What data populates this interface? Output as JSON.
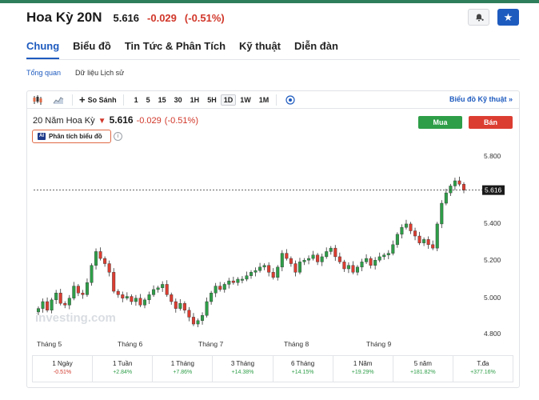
{
  "header": {
    "title": "Hoa Kỳ 20N",
    "price": "5.616",
    "change": "-0.029",
    "change_pct": "(-0.51%)"
  },
  "nav": {
    "tabs": [
      {
        "label": "Chung",
        "active": true
      },
      {
        "label": "Biểu đồ"
      },
      {
        "label": "Tin Tức & Phân Tích"
      },
      {
        "label": "Kỹ thuật"
      },
      {
        "label": "Diễn đàn"
      }
    ]
  },
  "subnav": {
    "items": [
      {
        "label": "Tổng quan",
        "active": true
      },
      {
        "label": "Dữ liệu Lịch sử"
      }
    ]
  },
  "toolbar": {
    "compare_label": "So Sánh",
    "intervals": [
      "1",
      "5",
      "15",
      "30",
      "1H",
      "5H",
      "1D",
      "1W",
      "1M"
    ],
    "active_interval": "1D",
    "right_link": "Biểu đồ Kỹ thuật »"
  },
  "instrument": {
    "name": "20 Năm Hoa Kỳ",
    "price": "5.616",
    "change": "-0.029",
    "change_pct": "(-0.51%)",
    "buy_label": "Mua",
    "sell_label": "Bán",
    "analysis_label": "Phân tích biểu đồ",
    "ai_badge": "AI",
    "info_glyph": "i"
  },
  "chart_data": {
    "type": "candlestick",
    "y_ticks": [
      "5.800",
      "5.400",
      "5.200",
      "5.000",
      "4.800"
    ],
    "ylim": [
      4.78,
      5.86
    ],
    "x_ticks": [
      "Tháng 5",
      "Tháng 6",
      "Tháng 7",
      "Tháng 8",
      "Tháng 9"
    ],
    "last_price_label": "5.616",
    "last_price": 5.616,
    "watermark": "investing.com",
    "up_color": "#2e9e48",
    "down_color": "#dc3d31",
    "candles_close": [
      4.93,
      4.97,
      4.92,
      4.98,
      5.02,
      4.96,
      4.95,
      4.99,
      5.06,
      5.02,
      5.01,
      5.08,
      5.18,
      5.26,
      5.22,
      5.19,
      5.14,
      5.03,
      5.01,
      4.99,
      5.0,
      4.97,
      4.99,
      4.95,
      4.98,
      5.01,
      5.04,
      5.05,
      5.07,
      5.01,
      4.97,
      4.93,
      4.96,
      4.92,
      4.88,
      4.84,
      4.86,
      4.89,
      4.97,
      5.02,
      5.06,
      5.04,
      5.07,
      5.09,
      5.08,
      5.1,
      5.1,
      5.12,
      5.14,
      5.15,
      5.17,
      5.18,
      5.14,
      5.11,
      5.17,
      5.25,
      5.22,
      5.19,
      5.14,
      5.2,
      5.21,
      5.22,
      5.24,
      5.2,
      5.23,
      5.26,
      5.28,
      5.23,
      5.2,
      5.16,
      5.18,
      5.14,
      5.17,
      5.2,
      5.22,
      5.18,
      5.21,
      5.23,
      5.24,
      5.25,
      5.3,
      5.36,
      5.4,
      5.42,
      5.38,
      5.35,
      5.31,
      5.33,
      5.3,
      5.28,
      5.42,
      5.54,
      5.6,
      5.64,
      5.67,
      5.65,
      5.616
    ]
  },
  "periods": [
    {
      "label": "1 Ngày",
      "value": "-0.51%",
      "dir": "neg"
    },
    {
      "label": "1 Tuần",
      "value": "+2.84%",
      "dir": "pos"
    },
    {
      "label": "1 Tháng",
      "value": "+7.86%",
      "dir": "pos"
    },
    {
      "label": "3 Tháng",
      "value": "+14.38%",
      "dir": "pos"
    },
    {
      "label": "6 Tháng",
      "value": "+14.15%",
      "dir": "pos"
    },
    {
      "label": "1 Năm",
      "value": "+19.29%",
      "dir": "pos"
    },
    {
      "label": "5 năm",
      "value": "+181.82%",
      "dir": "pos"
    },
    {
      "label": "T.đa",
      "value": "+377.16%",
      "dir": "pos"
    }
  ]
}
